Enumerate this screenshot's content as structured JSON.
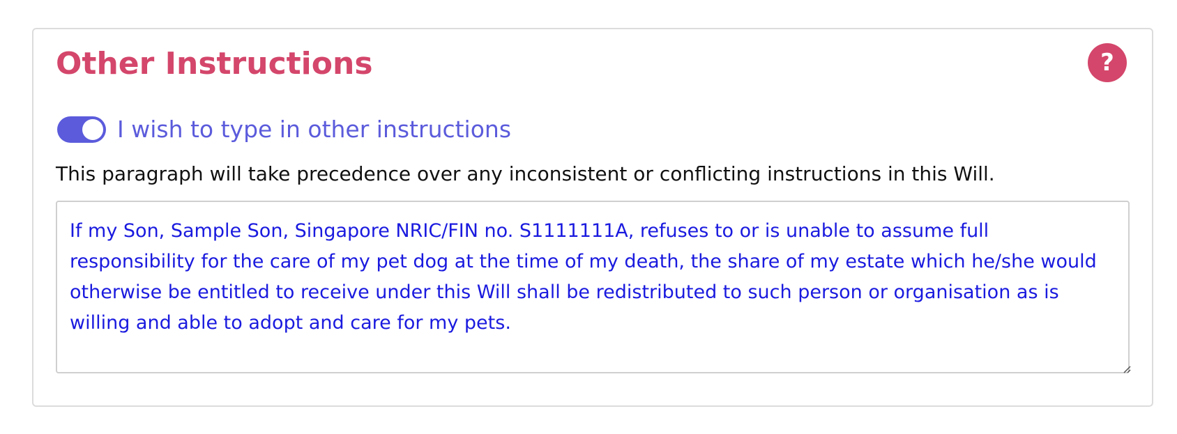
{
  "section": {
    "title": "Other Instructions",
    "help_icon": "question-mark-icon",
    "help_label": "?"
  },
  "toggle": {
    "label": "I wish to type in other instructions",
    "checked": true
  },
  "note": "This paragraph will take precedence over any inconsistent or conflicting instructions in this Will.",
  "instructions": {
    "value": "If my Son, Sample Son, Singapore NRIC/FIN no. S1111111A, refuses to or is unable to assume full responsibility for the care of my pet dog at the time of my death, the share of my estate which he/she would otherwise be entitled to receive under this Will shall be redistributed to such person or organisation as is willing and able to adopt and care for my pets."
  },
  "colors": {
    "accent_pink": "#d4466b",
    "toggle_purple": "#5b5bdc",
    "text_blue": "#1a1adf"
  }
}
